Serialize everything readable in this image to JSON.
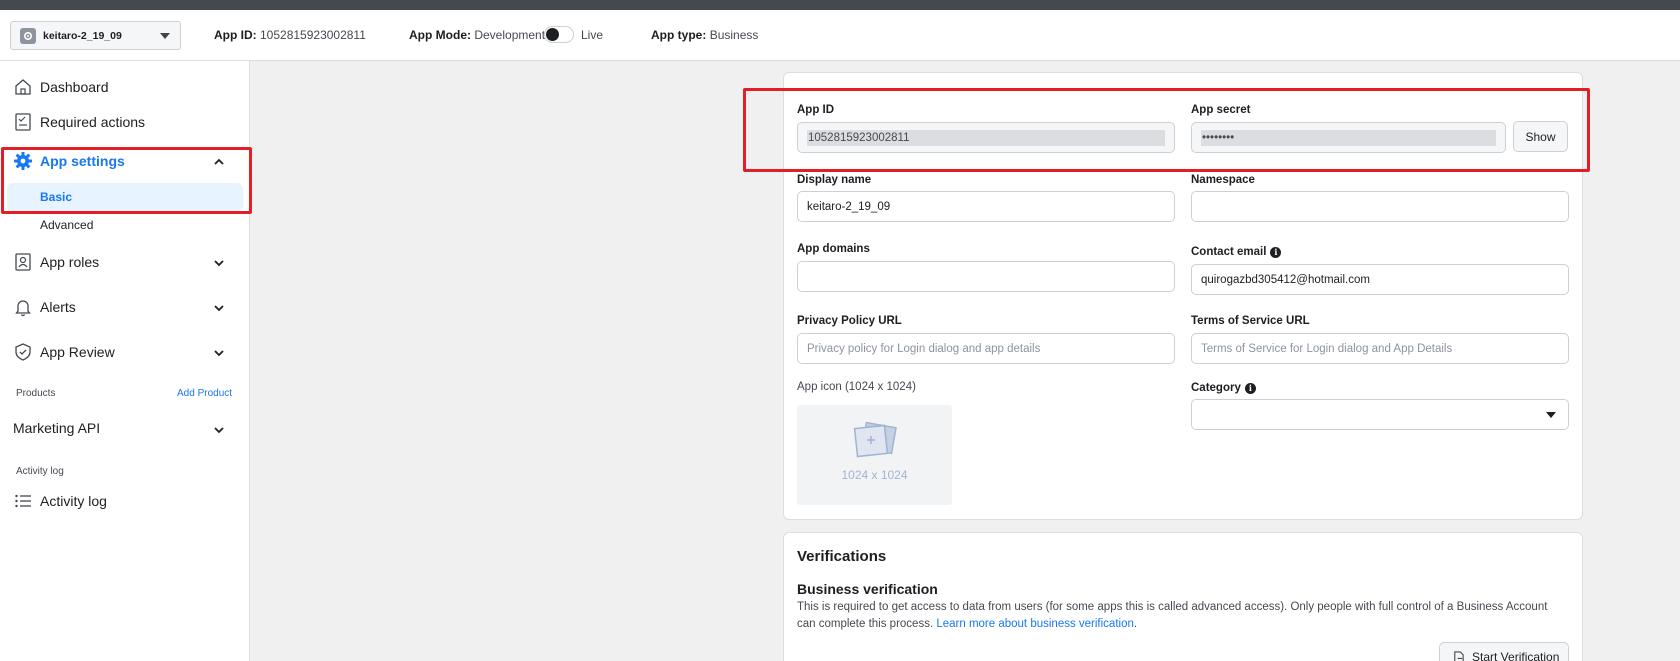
{
  "header": {
    "app_name": "keitaro-2_19_09",
    "app_id_label": "App ID:",
    "app_id_value": "1052815923002811",
    "app_mode_label": "App Mode:",
    "app_mode_value": "Development",
    "app_mode_live": "Live",
    "app_mode_is_live": false,
    "app_type_label": "App type:",
    "app_type_value": "Business"
  },
  "sidebar": {
    "dashboard": "Dashboard",
    "required_actions": "Required actions",
    "app_settings": "App settings",
    "basic": "Basic",
    "advanced": "Advanced",
    "app_roles": "App roles",
    "alerts": "Alerts",
    "app_review": "App Review",
    "products_label": "Products",
    "add_product": "Add Product",
    "marketing_api": "Marketing API",
    "activity_log_section": "Activity log",
    "activity_log": "Activity log"
  },
  "form": {
    "app_id_label": "App ID",
    "app_id_value": "1052815923002811",
    "app_secret_label": "App secret",
    "app_secret_value": "••••••••",
    "show_button": "Show",
    "display_name_label": "Display name",
    "display_name_value": "keitaro-2_19_09",
    "namespace_label": "Namespace",
    "namespace_value": "",
    "app_domains_label": "App domains",
    "app_domains_value": "",
    "contact_email_label": "Contact email",
    "contact_email_value": "quirogazbd305412@hotmail.com",
    "privacy_label": "Privacy Policy URL",
    "privacy_placeholder": "Privacy policy for Login dialog and app details",
    "tos_label": "Terms of Service URL",
    "tos_placeholder": "Terms of Service for Login dialog and App Details",
    "app_icon_label": "App icon (1024 x 1024)",
    "app_icon_dim": "1024 x 1024",
    "category_label": "Category",
    "category_value": ""
  },
  "verifications": {
    "title": "Verifications",
    "business_title": "Business verification",
    "business_desc": "This is required to get access to data from users (for some apps this is called advanced access). Only people with full control of a Business Account can complete this process. ",
    "learn_more": "Learn more about business verification",
    "desc_end": ".",
    "start_button": "Start Verification"
  },
  "colors": {
    "accent": "#1877f2",
    "highlight": "#e41e26",
    "active_bg": "#e7f3ff"
  }
}
